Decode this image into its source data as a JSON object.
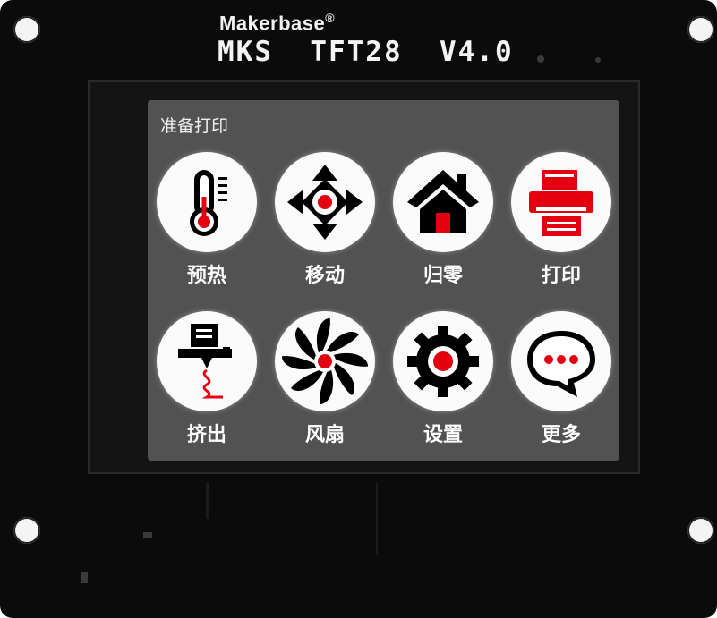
{
  "board": {
    "brand": "Makerbase",
    "trademark": "®",
    "model": "MKS  TFT28  V4.0"
  },
  "screen": {
    "title": "准备打印",
    "tiles": [
      {
        "label": "预热",
        "icon": "thermometer-icon"
      },
      {
        "label": "移动",
        "icon": "move-arrows-icon"
      },
      {
        "label": "归零",
        "icon": "home-icon"
      },
      {
        "label": "打印",
        "icon": "printer-icon"
      },
      {
        "label": "挤出",
        "icon": "extruder-icon"
      },
      {
        "label": "风扇",
        "icon": "fan-icon"
      },
      {
        "label": "设置",
        "icon": "gear-icon"
      },
      {
        "label": "更多",
        "icon": "more-chat-icon"
      }
    ]
  },
  "colors": {
    "accent": "#e3000f",
    "icon_dark": "#000000",
    "screen_bg": "#525252",
    "board": "#0b0b0b"
  }
}
